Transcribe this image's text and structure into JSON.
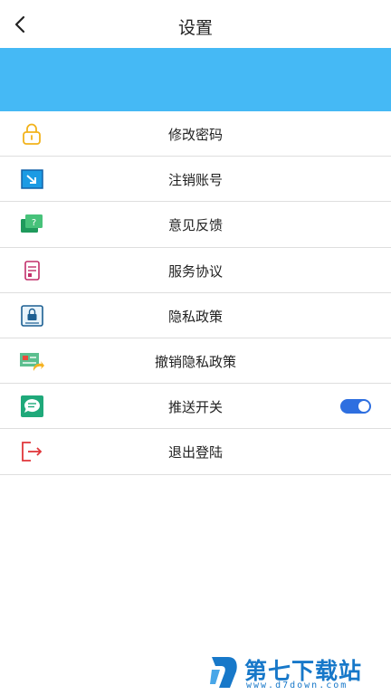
{
  "header": {
    "title": "设置",
    "back_icon": "chevron-left-icon"
  },
  "colors": {
    "banner": "#45b9f5",
    "toggle_on": "#2e6fe0",
    "divider": "#dedede",
    "watermark": "#1778c9"
  },
  "menu": {
    "items": [
      {
        "label": "修改密码",
        "icon": "lock-icon"
      },
      {
        "label": "注销账号",
        "icon": "logout-arrow-icon"
      },
      {
        "label": "意见反馈",
        "icon": "feedback-icon"
      },
      {
        "label": "服务协议",
        "icon": "document-icon"
      },
      {
        "label": "隐私政策",
        "icon": "privacy-icon"
      },
      {
        "label": "撤销隐私政策",
        "icon": "revoke-privacy-icon"
      },
      {
        "label": "推送开关",
        "icon": "message-icon",
        "toggle": true
      },
      {
        "label": "退出登陆",
        "icon": "exit-icon"
      }
    ]
  },
  "watermark": {
    "name": "第七下载站",
    "url": "www.d7down.com"
  }
}
